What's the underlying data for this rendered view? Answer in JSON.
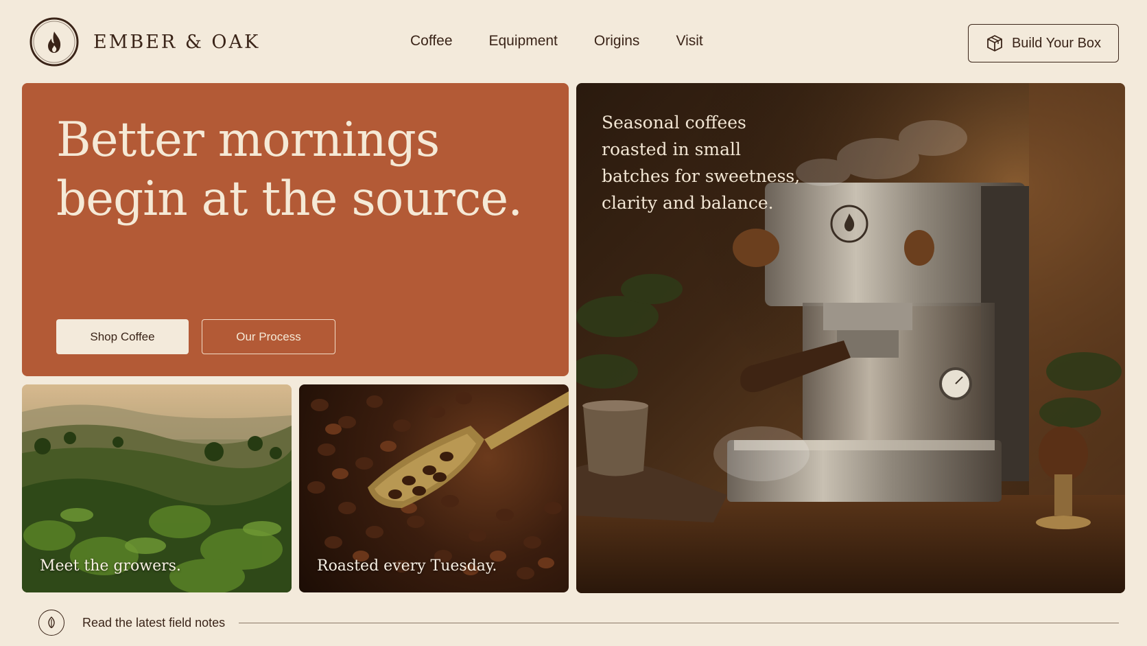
{
  "brand": {
    "name": "EMBER & OAK",
    "logo_icon": "flame-icon"
  },
  "nav": {
    "items": [
      {
        "label": "Coffee"
      },
      {
        "label": "Equipment"
      },
      {
        "label": "Origins"
      },
      {
        "label": "Visit"
      }
    ],
    "cta_label": "Build Your Box",
    "cta_icon": "box-icon"
  },
  "hero": {
    "title_line1": "Better mornings",
    "title_line2": "begin at the source.",
    "primary_button": "Shop Coffee",
    "secondary_button": "Our Process",
    "background_color": "#b35a36"
  },
  "tiles": {
    "growers_caption": "Meet the growers.",
    "beans_caption": "Roasted every Tuesday."
  },
  "feature": {
    "text": "Seasonal coffees roasted in small batches for sweetness, clarity and balance."
  },
  "footer": {
    "link_label": "Read the latest field notes",
    "icon": "leaf-icon"
  },
  "colors": {
    "background": "#f3eadb",
    "text_dark": "#3a2418",
    "accent": "#b35a36"
  }
}
